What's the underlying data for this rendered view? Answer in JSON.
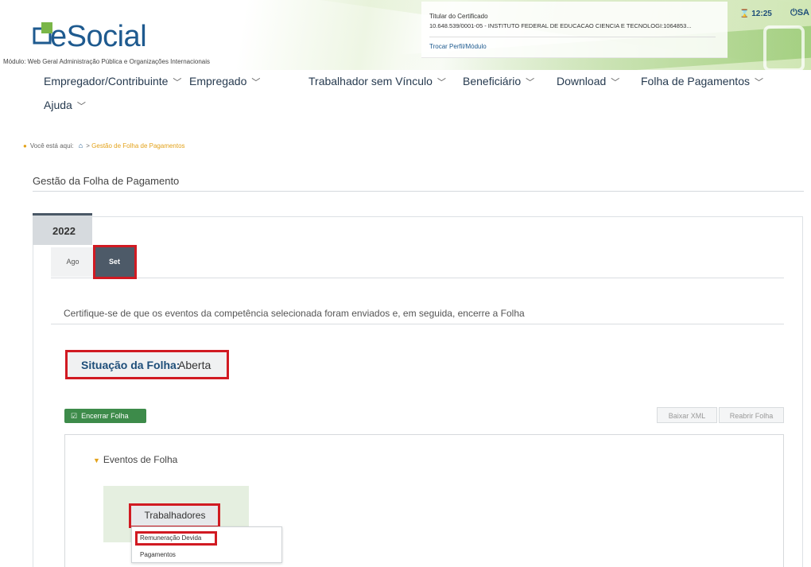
{
  "header": {
    "logo_text": "eSocial",
    "module": "Módulo: Web Geral Administração Pública e Organizações Internacionais",
    "cert_title": "Titular do Certificado",
    "cert_name": "10.648.539/0001-05 - INSTITUTO FEDERAL DE EDUCACAO CIENCIA E TECNOLOGI:1064853...",
    "switch_profile": "Trocar Perfil/Módulo",
    "clock": "12:25",
    "power_label": "SA"
  },
  "nav": {
    "items": [
      {
        "label": "Empregador/Contribuinte"
      },
      {
        "label": "Empregado"
      },
      {
        "label": "Trabalhador sem Vínculo"
      },
      {
        "label": "Beneficiário"
      },
      {
        "label": "Download"
      },
      {
        "label": "Folha de Pagamentos"
      },
      {
        "label": "Ajuda"
      }
    ]
  },
  "breadcrumb": {
    "prefix": "Você está aqui:",
    "current": "Gestão de Folha de Pagamentos"
  },
  "page_title": "Gestão da Folha de Pagamento",
  "year_tab": "2022",
  "months": {
    "first": "Ago",
    "selected": "Set"
  },
  "certify_text": "Certifique-se de que os eventos da competência selecionada foram enviados e, em seguida, encerre a Folha",
  "situation": {
    "label": "Situação da Folha:",
    "value": "Aberta"
  },
  "buttons": {
    "close_payroll": "Encerrar Folha",
    "download_xml": "Baixar XML",
    "reopen_payroll": "Reabrir Folha"
  },
  "events": {
    "title": "Eventos de Folha",
    "workers_button": "Trabalhadores",
    "menu": [
      "Remuneração Devida",
      "Pagamentos"
    ]
  },
  "colors": {
    "brand_blue": "#1e5a8f",
    "highlight_red": "#d11a22",
    "button_green": "#3d8b4a",
    "selected_month": "#4d5a68"
  }
}
